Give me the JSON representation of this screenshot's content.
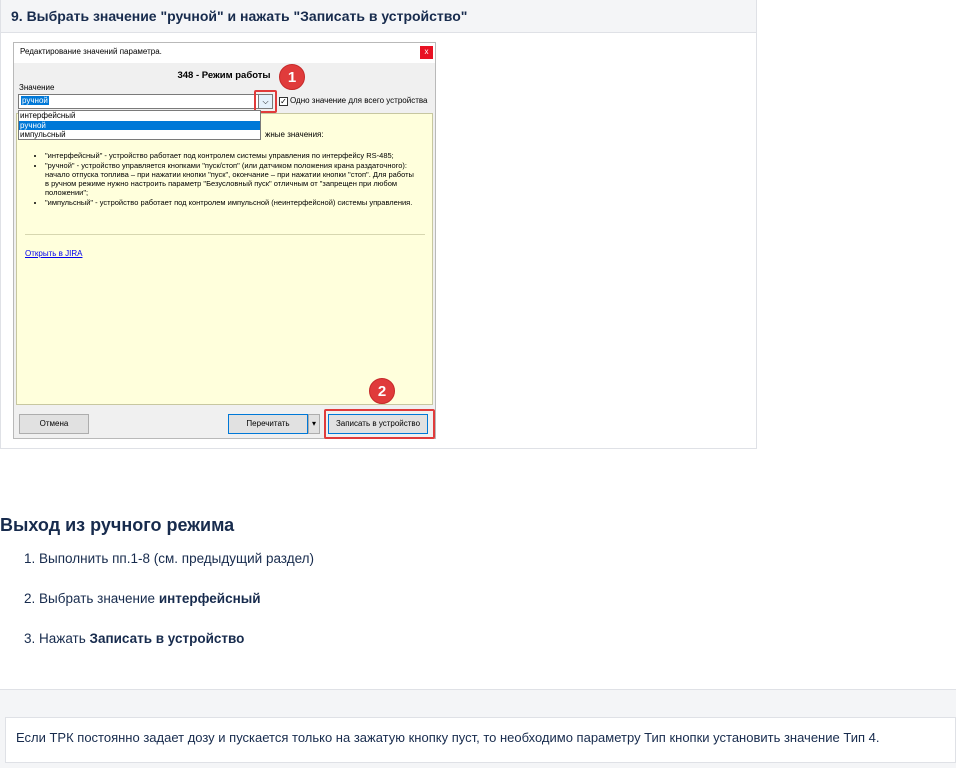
{
  "step": {
    "heading": "9. Выбрать значение \"ручной\" и нажать \"Записать в устройство\""
  },
  "dialog": {
    "title": "Редактирование значений параметра.",
    "close": "x",
    "param_title": "348 - Режим работы",
    "value_label": "Значение",
    "combo_value": "ручной",
    "combo_arrow": "⌵",
    "checkbox_mark": "✓",
    "checkbox_label": "Одно значение для всего устройства",
    "options": [
      "интерфейсный",
      "ручной",
      "импульсный"
    ],
    "possible_label": "жные значения:",
    "descriptions": [
      "\"интерфейсный\" - устройство работает под контролем системы управления по интерфейсу RS-485;",
      "\"ручной\" - устройство управляется кнопками \"пуск/стоп\" (или датчиком положения крана раздаточного): начало отпуска топлива – при нажатии кнопки \"пуск\", окончание – при нажатии кнопки \"стоп\". Для работы в ручном режиме нужно настроить параметр \"Безусловный пуск\" отличным от \"запрещен при любом положении\";",
      "\"импульсный\" - устройство работает под контролем импульсной (неинтерфейсной) системы управления."
    ],
    "jira_link": "Открыть в JIRA",
    "cancel_label": "Отмена",
    "reread_label": "Перечитать",
    "split_arrow": "▾",
    "write_label": "Записать в устройство",
    "badge1": "1",
    "badge2": "2",
    "accent_color": "#e03b3b"
  },
  "exit": {
    "title": "Выход из ручного режима",
    "steps": [
      {
        "num": "1.",
        "text": "Выполнить пп.1-8 (см. предыдущий раздел)",
        "bold": ""
      },
      {
        "num": "2.",
        "text": "Выбрать значение ",
        "bold": "интерфейсный"
      },
      {
        "num": "3.",
        "text": "Нажать ",
        "bold": "Записать в устройство"
      }
    ]
  },
  "note": {
    "text": "Если ТРК постоянно задает дозу и пускается только на зажатую кнопку пуст, то необходимо параметру Тип кнопки установить значение Тип 4."
  }
}
